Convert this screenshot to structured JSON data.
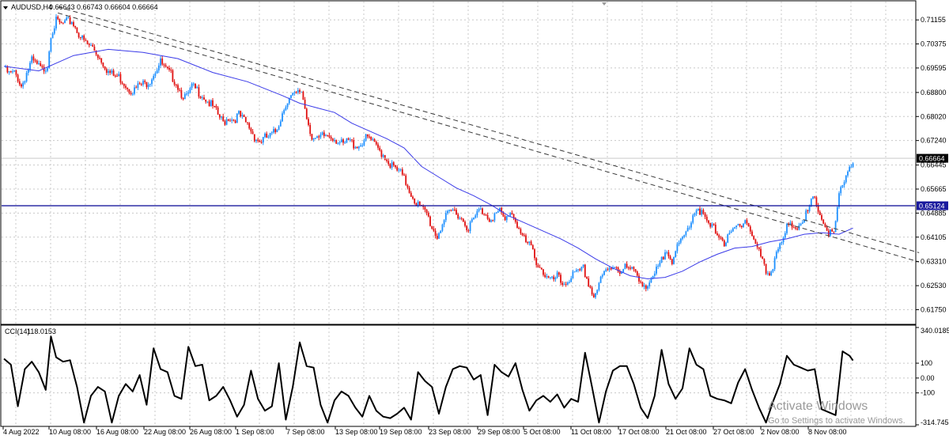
{
  "header": {
    "symbol_timeframe": "AUDUSD,H4",
    "ohlc": "0.66643 0.66743 0.66604 0.66664"
  },
  "indicator_header": {
    "name": "CCI(14)",
    "value": "118.0153"
  },
  "price_badges": {
    "current": "0.66664",
    "horizontal": "0.65124"
  },
  "watermark": {
    "line1": "Activate Windows",
    "line2": "Go to Settings to activate Windows."
  },
  "colors": {
    "bull": "#1e90ff",
    "bear": "#e01010",
    "ma": "#3a3ae8",
    "hline": "#1a1a9e",
    "grid": "#c8c8c8",
    "cci": "#000000",
    "trend": "#3a3a3a"
  },
  "chart_data": [
    {
      "type": "candlestick",
      "symbol": "AUDUSD",
      "timeframe": "H4",
      "ylim": [
        0.613,
        0.7175
      ],
      "y_ticks": [
        "0.71155",
        "0.70375",
        "0.69595",
        "0.68800",
        "0.68020",
        "0.67240",
        "0.66445",
        "0.65665",
        "0.64885",
        "0.64105",
        "0.63310",
        "0.62530",
        "0.61750"
      ],
      "x_tick_labels": [
        "4 Aug 2022",
        "10 Aug 08:00",
        "16 Aug 08:00",
        "22 Aug 08:00",
        "26 Aug 08:00",
        "1 Sep 08:00",
        "7 Sep 08:00",
        "13 Sep 08:00",
        "19 Sep 08:00",
        "23 Sep 08:00",
        "29 Sep 08:00",
        "5 Oct 08:00",
        "11 Oct 08:00",
        "17 Oct 08:00",
        "21 Oct 08:00",
        "27 Oct 08:00",
        "2 Nov 08:00",
        "8 Nov 08:00"
      ],
      "close_path": [
        [
          0,
          0.6962
        ],
        [
          3,
          0.6948
        ],
        [
          6,
          0.695
        ],
        [
          8,
          0.6935
        ],
        [
          10,
          0.6908
        ],
        [
          13,
          0.6952
        ],
        [
          16,
          0.699
        ],
        [
          19,
          0.6976
        ],
        [
          22,
          0.696
        ],
        [
          25,
          0.6978
        ],
        [
          27,
          0.708
        ],
        [
          30,
          0.7118
        ],
        [
          33,
          0.7108
        ],
        [
          36,
          0.7115
        ],
        [
          39,
          0.712
        ],
        [
          42,
          0.709
        ],
        [
          45,
          0.706
        ],
        [
          48,
          0.7042
        ],
        [
          51,
          0.7035
        ],
        [
          54,
          0.701
        ],
        [
          57,
          0.6985
        ],
        [
          60,
          0.6955
        ],
        [
          63,
          0.6942
        ],
        [
          66,
          0.6938
        ],
        [
          69,
          0.692
        ],
        [
          72,
          0.69
        ],
        [
          75,
          0.6895
        ],
        [
          78,
          0.6912
        ],
        [
          81,
          0.6915
        ],
        [
          84,
          0.693
        ],
        [
          87,
          0.696
        ],
        [
          90,
          0.6985
        ],
        [
          93,
          0.696
        ],
        [
          96,
          0.6945
        ],
        [
          99,
          0.692
        ],
        [
          102,
          0.6885
        ],
        [
          105,
          0.687
        ],
        [
          108,
          0.6905
        ],
        [
          111,
          0.6895
        ],
        [
          114,
          0.688
        ],
        [
          117,
          0.686
        ],
        [
          120,
          0.684
        ],
        [
          123,
          0.6815
        ],
        [
          126,
          0.679
        ],
        [
          129,
          0.6808
        ],
        [
          132,
          0.68
        ],
        [
          135,
          0.6815
        ],
        [
          138,
          0.6795
        ],
        [
          141,
          0.6775
        ],
        [
          144,
          0.6745
        ],
        [
          147,
          0.6728
        ],
        [
          150,
          0.674
        ],
        [
          153,
          0.6745
        ],
        [
          156,
          0.676
        ],
        [
          159,
          0.6805
        ],
        [
          162,
          0.6855
        ],
        [
          165,
          0.6872
        ],
        [
          168,
          0.688
        ],
        [
          171,
          0.6895
        ],
        [
          174,
          0.681
        ],
        [
          177,
          0.6745
        ],
        [
          180,
          0.673
        ],
        [
          183,
          0.6745
        ],
        [
          186,
          0.675
        ],
        [
          189,
          0.6745
        ],
        [
          192,
          0.673
        ],
        [
          195,
          0.6715
        ],
        [
          198,
          0.6732
        ],
        [
          201,
          0.672
        ],
        [
          204,
          0.6715
        ],
        [
          207,
          0.6735
        ],
        [
          210,
          0.674
        ],
        [
          213,
          0.6715
        ],
        [
          216,
          0.67
        ],
        [
          219,
          0.668
        ],
        [
          222,
          0.6655
        ],
        [
          225,
          0.6638
        ],
        [
          228,
          0.6625
        ],
        [
          231,
          0.6595
        ],
        [
          234,
          0.656
        ],
        [
          237,
          0.653
        ],
        [
          240,
          0.651
        ],
        [
          243,
          0.6495
        ],
        [
          246,
          0.645
        ],
        [
          249,
          0.642
        ],
        [
          252,
          0.6465
        ],
        [
          255,
          0.6488
        ],
        [
          258,
          0.6505
        ],
        [
          261,
          0.6495
        ],
        [
          264,
          0.647
        ],
        [
          267,
          0.645
        ],
        [
          270,
          0.6475
        ],
        [
          273,
          0.6505
        ],
        [
          276,
          0.65
        ],
        [
          279,
          0.648
        ],
        [
          282,
          0.649
        ],
        [
          285,
          0.65
        ],
        [
          288,
          0.647
        ],
        [
          291,
          0.6505
        ],
        [
          294,
          0.6475
        ],
        [
          297,
          0.643
        ],
        [
          300,
          0.64
        ],
        [
          303,
          0.6385
        ],
        [
          306,
          0.634
        ],
        [
          309,
          0.6315
        ],
        [
          312,
          0.6285
        ],
        [
          315,
          0.6275
        ],
        [
          318,
          0.629
        ],
        [
          321,
          0.6265
        ],
        [
          324,
          0.6278
        ],
        [
          327,
          0.6295
        ],
        [
          330,
          0.63
        ],
        [
          333,
          0.6315
        ],
        [
          336,
          0.627
        ],
        [
          339,
          0.6225
        ],
        [
          342,
          0.6265
        ],
        [
          345,
          0.63
        ],
        [
          348,
          0.6315
        ],
        [
          351,
          0.633
        ],
        [
          354,
          0.631
        ],
        [
          357,
          0.632
        ],
        [
          360,
          0.631
        ],
        [
          363,
          0.6305
        ],
        [
          366,
          0.628
        ],
        [
          369,
          0.6255
        ],
        [
          372,
          0.627
        ],
        [
          375,
          0.6308
        ],
        [
          378,
          0.634
        ],
        [
          381,
          0.6385
        ],
        [
          384,
          0.6345
        ],
        [
          387,
          0.638
        ],
        [
          390,
          0.641
        ],
        [
          393,
          0.6445
        ],
        [
          396,
          0.6495
        ],
        [
          399,
          0.6515
        ],
        [
          402,
          0.6485
        ],
        [
          405,
          0.6455
        ],
        [
          408,
          0.6445
        ],
        [
          411,
          0.643
        ],
        [
          414,
          0.64
        ],
        [
          417,
          0.642
        ],
        [
          420,
          0.6445
        ],
        [
          423,
          0.646
        ],
        [
          426,
          0.648
        ],
        [
          429,
          0.644
        ],
        [
          432,
          0.6395
        ],
        [
          435,
          0.6355
        ],
        [
          438,
          0.6305
        ],
        [
          441,
          0.6308
        ],
        [
          444,
          0.6375
        ],
        [
          447,
          0.639
        ],
        [
          450,
          0.645
        ],
        [
          453,
          0.6455
        ],
        [
          456,
          0.6455
        ],
        [
          459,
          0.648
        ],
        [
          462,
          0.6495
        ],
        [
          465,
          0.6545
        ],
        [
          468,
          0.651
        ],
        [
          471,
          0.6465
        ],
        [
          474,
          0.6432
        ],
        [
          477,
          0.6425
        ],
        [
          480,
          0.655
        ],
        [
          483,
          0.6605
        ],
        [
          486,
          0.665
        ],
        [
          488,
          0.6666
        ]
      ],
      "moving_average_path": [
        [
          0,
          0.6965
        ],
        [
          20,
          0.695
        ],
        [
          40,
          0.7
        ],
        [
          60,
          0.702
        ],
        [
          80,
          0.701
        ],
        [
          100,
          0.699
        ],
        [
          120,
          0.6945
        ],
        [
          140,
          0.6915
        ],
        [
          160,
          0.687
        ],
        [
          170,
          0.6845
        ],
        [
          180,
          0.683
        ],
        [
          190,
          0.6815
        ],
        [
          200,
          0.678
        ],
        [
          210,
          0.6755
        ],
        [
          220,
          0.673
        ],
        [
          230,
          0.67
        ],
        [
          240,
          0.664
        ],
        [
          250,
          0.6605
        ],
        [
          260,
          0.657
        ],
        [
          270,
          0.6545
        ],
        [
          280,
          0.6515
        ],
        [
          290,
          0.648
        ],
        [
          300,
          0.6455
        ],
        [
          310,
          0.643
        ],
        [
          320,
          0.6405
        ],
        [
          330,
          0.6375
        ],
        [
          340,
          0.634
        ],
        [
          350,
          0.631
        ],
        [
          360,
          0.6285
        ],
        [
          370,
          0.6275
        ],
        [
          380,
          0.628
        ],
        [
          390,
          0.63
        ],
        [
          400,
          0.633
        ],
        [
          410,
          0.6355
        ],
        [
          420,
          0.6375
        ],
        [
          430,
          0.638
        ],
        [
          440,
          0.6395
        ],
        [
          450,
          0.6405
        ],
        [
          460,
          0.642
        ],
        [
          470,
          0.6425
        ],
        [
          480,
          0.642
        ],
        [
          488,
          0.644
        ]
      ],
      "trend_lines": [
        [
          [
            31,
            0.7158
          ],
          [
            526,
            0.636
          ]
        ],
        [
          [
            31,
            0.7138
          ],
          [
            526,
            0.633
          ]
        ]
      ],
      "horizontal_line": 0.65124,
      "bar_count": 489
    },
    {
      "type": "line",
      "name": "CCI(14)",
      "ylim": [
        -314.7458,
        340.0185
      ],
      "y_ticks": [
        "340.0185",
        "100",
        "0.00",
        "-100",
        "-314.7458"
      ],
      "values_path": [
        [
          0,
          130
        ],
        [
          4,
          90
        ],
        [
          8,
          -190
        ],
        [
          12,
          60
        ],
        [
          16,
          110
        ],
        [
          20,
          40
        ],
        [
          24,
          -80
        ],
        [
          27,
          280
        ],
        [
          30,
          140
        ],
        [
          34,
          110
        ],
        [
          38,
          120
        ],
        [
          42,
          -60
        ],
        [
          46,
          -300
        ],
        [
          50,
          -120
        ],
        [
          54,
          -60
        ],
        [
          58,
          -90
        ],
        [
          62,
          -300
        ],
        [
          66,
          -120
        ],
        [
          70,
          -40
        ],
        [
          74,
          -90
        ],
        [
          78,
          20
        ],
        [
          82,
          -180
        ],
        [
          86,
          200
        ],
        [
          90,
          60
        ],
        [
          94,
          40
        ],
        [
          98,
          -120
        ],
        [
          102,
          -140
        ],
        [
          106,
          210
        ],
        [
          110,
          80
        ],
        [
          114,
          90
        ],
        [
          118,
          -150
        ],
        [
          122,
          -120
        ],
        [
          126,
          -60
        ],
        [
          130,
          -150
        ],
        [
          134,
          -260
        ],
        [
          138,
          -180
        ],
        [
          142,
          50
        ],
        [
          146,
          -140
        ],
        [
          150,
          -220
        ],
        [
          154,
          -190
        ],
        [
          158,
          100
        ],
        [
          162,
          -280
        ],
        [
          166,
          -60
        ],
        [
          170,
          240
        ],
        [
          174,
          80
        ],
        [
          178,
          70
        ],
        [
          182,
          -180
        ],
        [
          186,
          -300
        ],
        [
          190,
          -150
        ],
        [
          194,
          -90
        ],
        [
          198,
          -120
        ],
        [
          202,
          -200
        ],
        [
          206,
          -260
        ],
        [
          210,
          -120
        ],
        [
          214,
          -220
        ],
        [
          218,
          -260
        ],
        [
          222,
          -270
        ],
        [
          226,
          -240
        ],
        [
          230,
          -200
        ],
        [
          234,
          -280
        ],
        [
          238,
          40
        ],
        [
          242,
          -20
        ],
        [
          246,
          -60
        ],
        [
          250,
          -240
        ],
        [
          254,
          -60
        ],
        [
          258,
          60
        ],
        [
          262,
          80
        ],
        [
          266,
          70
        ],
        [
          270,
          -10
        ],
        [
          274,
          20
        ],
        [
          278,
          -250
        ],
        [
          282,
          90
        ],
        [
          286,
          40
        ],
        [
          290,
          10
        ],
        [
          294,
          100
        ],
        [
          298,
          -80
        ],
        [
          302,
          -220
        ],
        [
          306,
          -150
        ],
        [
          310,
          -120
        ],
        [
          314,
          -160
        ],
        [
          318,
          -110
        ],
        [
          322,
          -200
        ],
        [
          326,
          -140
        ],
        [
          330,
          -160
        ],
        [
          334,
          170
        ],
        [
          338,
          -60
        ],
        [
          342,
          -300
        ],
        [
          346,
          -90
        ],
        [
          350,
          50
        ],
        [
          354,
          80
        ],
        [
          358,
          80
        ],
        [
          362,
          -40
        ],
        [
          366,
          -200
        ],
        [
          370,
          -270
        ],
        [
          374,
          -120
        ],
        [
          378,
          190
        ],
        [
          382,
          -40
        ],
        [
          386,
          -140
        ],
        [
          390,
          -70
        ],
        [
          394,
          200
        ],
        [
          398,
          90
        ],
        [
          402,
          60
        ],
        [
          406,
          -120
        ],
        [
          410,
          -140
        ],
        [
          414,
          -150
        ],
        [
          418,
          -170
        ],
        [
          422,
          -30
        ],
        [
          426,
          60
        ],
        [
          430,
          -80
        ],
        [
          434,
          -200
        ],
        [
          438,
          -300
        ],
        [
          442,
          -160
        ],
        [
          446,
          -40
        ],
        [
          450,
          150
        ],
        [
          454,
          90
        ],
        [
          458,
          70
        ],
        [
          462,
          50
        ],
        [
          466,
          60
        ],
        [
          470,
          -210
        ],
        [
          474,
          -230
        ],
        [
          478,
          -250
        ],
        [
          482,
          180
        ],
        [
          486,
          150
        ],
        [
          488,
          118
        ]
      ]
    }
  ]
}
